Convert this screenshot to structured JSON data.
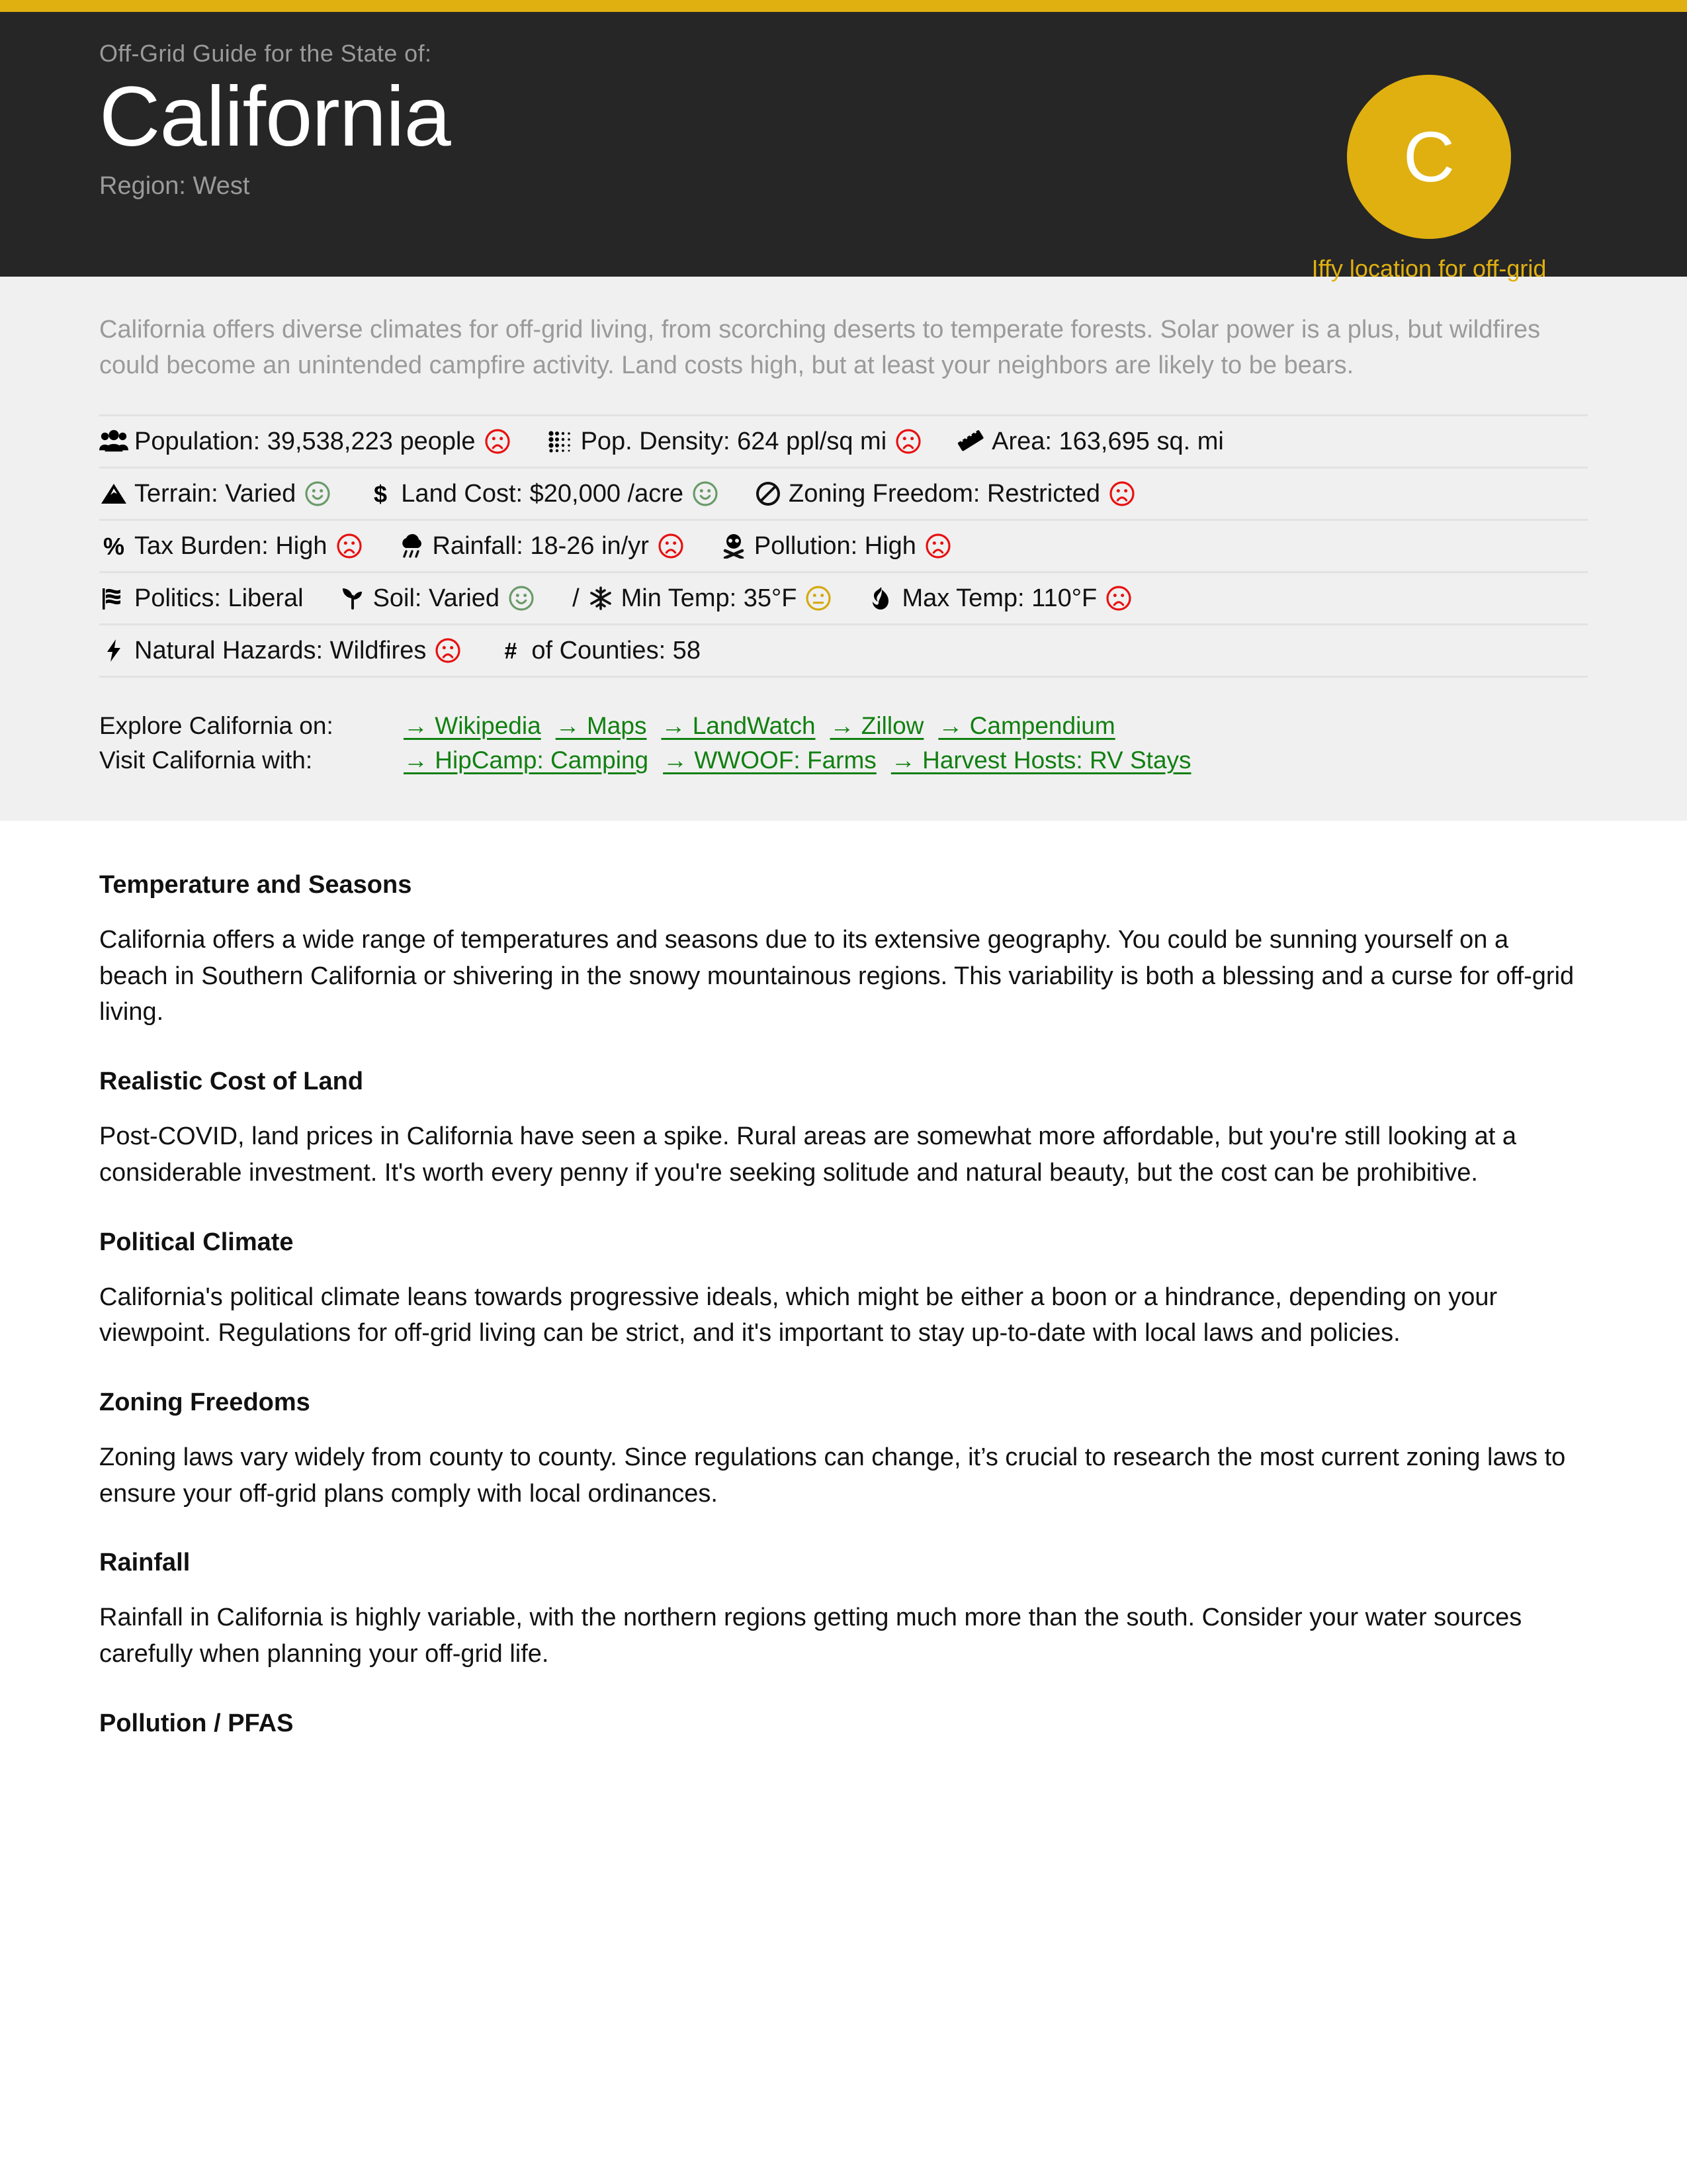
{
  "accent_color": "#e0b010",
  "link_color": "#118011",
  "header": {
    "kicker": "Off-Grid Guide for the State of:",
    "title": "California",
    "region": "Region: West",
    "grade_letter": "C",
    "grade_caption": "Iffy location for off-grid"
  },
  "panel": {
    "intro": "California offers diverse climates for off-grid living, from scorching deserts to temperate forests. Solar power is a plus, but wildfires could become an unintended campfire activity. Land costs high, but at least your neighbors are likely to be bears.",
    "rows": [
      [
        {
          "icon": "users-icon",
          "text": "Population: 39,538,223 people",
          "face": "sad",
          "face_color": "#e81010"
        },
        {
          "icon": "density-dots-icon",
          "text": "Pop. Density: 624 ppl/sq mi",
          "face": "sad",
          "face_color": "#e81010"
        },
        {
          "icon": "ruler-icon",
          "text": "Area: 163,695 sq. mi",
          "face": "none",
          "face_color": ""
        }
      ],
      [
        {
          "icon": "mountain-icon",
          "text": "Terrain: Varied",
          "face": "happy",
          "face_color": "#6a9a6a"
        },
        {
          "icon": "dollar-icon",
          "text": "Land Cost: $20,000 /acre",
          "face": "happy",
          "face_color": "#6a9a6a"
        },
        {
          "icon": "ban-icon",
          "text": "Zoning Freedom: Restricted",
          "face": "sad",
          "face_color": "#e81010"
        }
      ],
      [
        {
          "icon": "percent-icon",
          "text": "Tax Burden: High",
          "face": "sad",
          "face_color": "#e81010"
        },
        {
          "icon": "rain-cloud-icon",
          "text": "Rainfall: 18-26 in/yr",
          "face": "sad",
          "face_color": "#e81010"
        },
        {
          "icon": "skull-icon",
          "text": "Pollution: High",
          "face": "sad",
          "face_color": "#e81010"
        }
      ],
      [
        {
          "icon": "flag-icon",
          "text": "Politics: Liberal",
          "face": "none",
          "face_color": ""
        },
        {
          "icon": "seedling-icon",
          "text": "Soil: Varied",
          "face": "happy",
          "face_color": "#6a9a6a"
        },
        {
          "icon": "snowflake-icon",
          "text": "Min Temp: 35°F",
          "face": "neutral",
          "face_color": "#d4a910",
          "separator": "/"
        },
        {
          "icon": "fire-icon",
          "text": "Max Temp: 110°F",
          "face": "sad",
          "face_color": "#e81010"
        }
      ],
      [
        {
          "icon": "bolt-icon",
          "text": "Natural Hazards: Wildfires",
          "face": "sad",
          "face_color": "#e81010"
        },
        {
          "icon": "hash-icon",
          "text": "of Counties: 58",
          "face": "none",
          "face_color": ""
        }
      ]
    ],
    "explore_label": "Explore California on:",
    "explore_links": [
      "→ Wikipedia",
      "→ Maps",
      "→ LandWatch",
      "→ Zillow",
      "→ Campendium"
    ],
    "visit_label": "Visit California with:",
    "visit_links": [
      "→ HipCamp: Camping",
      "→ WWOOF: Farms",
      "→ Harvest Hosts: RV Stays"
    ]
  },
  "sections": [
    {
      "heading": "Temperature and Seasons",
      "body": "California offers a wide range of temperatures and seasons due to its extensive geography. You could be sunning yourself on a beach in Southern California or shivering in the snowy mountainous regions. This variability is both a blessing and a curse for off-grid living."
    },
    {
      "heading": "Realistic Cost of Land",
      "body": "Post-COVID, land prices in California have seen a spike. Rural areas are somewhat more affordable, but you're still looking at a considerable investment. It's worth every penny if you're seeking solitude and natural beauty, but the cost can be prohibitive."
    },
    {
      "heading": "Political Climate",
      "body": "California's political climate leans towards progressive ideals, which might be either a boon or a hindrance, depending on your viewpoint. Regulations for off-grid living can be strict, and it's important to stay up-to-date with local laws and policies."
    },
    {
      "heading": "Zoning Freedoms",
      "body": "Zoning laws vary widely from county to county. Since regulations can change, it’s crucial to research the most current zoning laws to ensure your off-grid plans comply with local ordinances."
    },
    {
      "heading": "Rainfall",
      "body": "Rainfall in California is highly variable, with the northern regions getting much more than the south. Consider your water sources carefully when planning your off-grid life."
    },
    {
      "heading": "Pollution / PFAS",
      "body": ""
    }
  ]
}
